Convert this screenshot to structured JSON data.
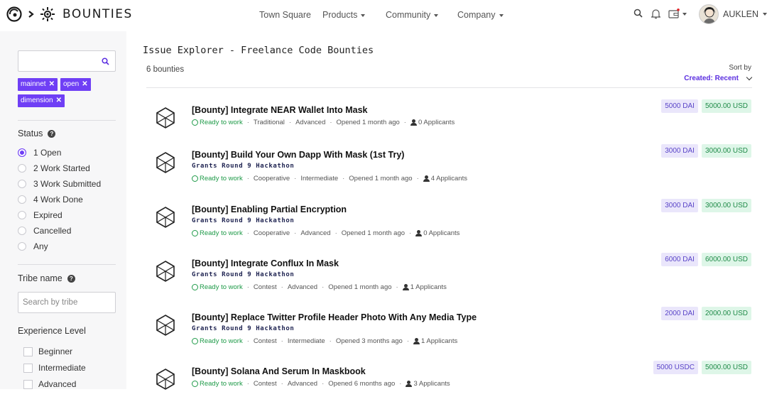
{
  "header": {
    "brand": "BOUNTIES",
    "nav": [
      {
        "label": "Town Square",
        "dropdown": false
      },
      {
        "label": "Products",
        "dropdown": true
      },
      {
        "label": "Community",
        "dropdown": true
      },
      {
        "label": "Company",
        "dropdown": true
      }
    ],
    "user": {
      "name": "AUKLEN"
    },
    "icons": [
      "search-icon",
      "bell-icon",
      "wallet-icon"
    ],
    "accent": "#6f3ff5"
  },
  "sidebar": {
    "search": {
      "value": "",
      "placeholder": ""
    },
    "chips": [
      "mainnet",
      "open",
      "dimension"
    ],
    "status": {
      "title": "Status",
      "options": [
        {
          "label": "1 Open",
          "checked": true
        },
        {
          "label": "2 Work Started",
          "checked": false
        },
        {
          "label": "3 Work Submitted",
          "checked": false
        },
        {
          "label": "4 Work Done",
          "checked": false
        },
        {
          "label": "Expired",
          "checked": false
        },
        {
          "label": "Cancelled",
          "checked": false
        },
        {
          "label": "Any",
          "checked": false
        }
      ]
    },
    "tribe": {
      "title": "Tribe name",
      "placeholder": "Search by tribe"
    },
    "experience": {
      "title": "Experience Level",
      "options": [
        "Beginner",
        "Intermediate",
        "Advanced"
      ]
    }
  },
  "main": {
    "title": "Issue Explorer - Freelance Code Bounties",
    "count": "6 bounties",
    "sort": {
      "label": "Sort by",
      "value": "Created: Recent"
    },
    "bounties": [
      {
        "title": "[Bounty] Integrate NEAR Wallet Into Mask",
        "grant": "",
        "status": "Ready to work",
        "type": "Traditional",
        "level": "Advanced",
        "opened": "Opened 1 month ago",
        "applicants": "0 Applicants",
        "crypto": "5000 DAI",
        "usd": "5000.00 USD"
      },
      {
        "title": "[Bounty] Build Your Own Dapp With Mask (1st Try)",
        "grant": "Grants Round 9 Hackathon",
        "status": "Ready to work",
        "type": "Cooperative",
        "level": "Intermediate",
        "opened": "Opened 1 month ago",
        "applicants": "4 Applicants",
        "crypto": "3000 DAI",
        "usd": "3000.00 USD"
      },
      {
        "title": "[Bounty] Enabling Partial Encryption",
        "grant": "Grants Round 9 Hackathon",
        "status": "Ready to work",
        "type": "Cooperative",
        "level": "Advanced",
        "opened": "Opened 1 month ago",
        "applicants": "0 Applicants",
        "crypto": "3000 DAI",
        "usd": "3000.00 USD"
      },
      {
        "title": "[Bounty] Integrate Conflux In Mask",
        "grant": "Grants Round 9 Hackathon",
        "status": "Ready to work",
        "type": "Contest",
        "level": "Advanced",
        "opened": "Opened 1 month ago",
        "applicants": "1 Applicants",
        "crypto": "6000 DAI",
        "usd": "6000.00 USD"
      },
      {
        "title": "[Bounty] Replace Twitter Profile Header Photo With Any Media Type",
        "grant": "Grants Round 9 Hackathon",
        "status": "Ready to work",
        "type": "Contest",
        "level": "Intermediate",
        "opened": "Opened 3 months ago",
        "applicants": "1 Applicants",
        "crypto": "2000 DAI",
        "usd": "2000.00 USD"
      },
      {
        "title": "[Bounty] Solana And Serum In Maskbook",
        "grant": "",
        "status": "Ready to work",
        "type": "Contest",
        "level": "Advanced",
        "opened": "Opened 6 months ago",
        "applicants": "3 Applicants",
        "crypto": "5000 USDC",
        "usd": "5000.00 USD"
      }
    ]
  }
}
